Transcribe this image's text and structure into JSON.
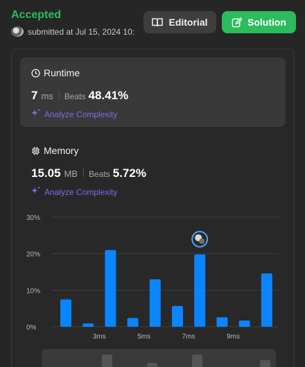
{
  "header": {
    "status": "Accepted",
    "submitted_text": "submitted at Jul 15, 2024 10:",
    "editorial_label": "Editorial",
    "solution_label": "Solution"
  },
  "runtime": {
    "title": "Runtime",
    "value": "7",
    "unit": "ms",
    "beats_label": "Beats",
    "beats_value": "48.41%",
    "analyze_label": "Analyze Complexity"
  },
  "memory": {
    "title": "Memory",
    "value": "15.05",
    "unit": "MB",
    "beats_label": "Beats",
    "beats_value": "5.72%",
    "analyze_label": "Analyze Complexity"
  },
  "colors": {
    "accepted": "#2cbb5d",
    "bar": "#0a84ff",
    "analyze": "#7d6bea",
    "avatar_ring": "#4aa3ff"
  },
  "chart_data": {
    "type": "bar",
    "y_ticks": [
      "30%",
      "20%",
      "10%",
      "0%"
    ],
    "ylim": [
      0,
      30
    ],
    "x_tick_labels": [
      "3ms",
      "5ms",
      "7ms",
      "9ms"
    ],
    "x": [
      1,
      2,
      3,
      4,
      5,
      6,
      7,
      8,
      9,
      10,
      11
    ],
    "values": [
      7.5,
      0.9,
      21,
      2.4,
      13,
      5.7,
      19.8,
      2.6,
      1.7,
      14.6
    ],
    "highlight_marker": "user-avatar-at-7ms"
  }
}
